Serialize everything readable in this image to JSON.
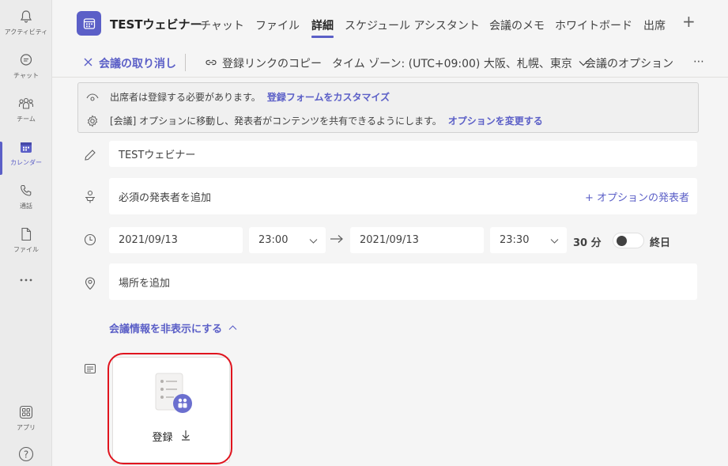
{
  "rail": {
    "items": [
      {
        "label": "アクティビティ",
        "icon": "bell-icon"
      },
      {
        "label": "チャット",
        "icon": "chat-icon"
      },
      {
        "label": "チーム",
        "icon": "teams-icon"
      },
      {
        "label": "カレンダー",
        "icon": "calendar-icon",
        "active": true
      },
      {
        "label": "通話",
        "icon": "phone-icon"
      },
      {
        "label": "ファイル",
        "icon": "file-icon"
      },
      {
        "label": "",
        "icon": "more-icon"
      },
      {
        "label": "アプリ",
        "icon": "apps-icon"
      },
      {
        "label": "",
        "icon": "help-icon"
      }
    ]
  },
  "header": {
    "title": "TESTウェビナー",
    "tabs": [
      {
        "label": "チャット"
      },
      {
        "label": "ファイル"
      },
      {
        "label": "詳細",
        "active": true
      },
      {
        "label": "スケジュール アシスタント"
      },
      {
        "label": "会議のメモ"
      },
      {
        "label": "ホワイトボード"
      },
      {
        "label": "出席"
      }
    ],
    "add_tab": "+"
  },
  "toolbar": {
    "cancel_label": "会議の取り消し",
    "copy_link_label": "登録リンクのコピー",
    "timezone_label": "タイム ゾーン: (UTC+09:00) 大阪、札幌、東京",
    "options_label": "会議のオプション",
    "more_label": "⋯"
  },
  "notice": {
    "line1_text": "出席者は登録する必要があります。",
    "line1_link": "登録フォームをカスタマイズ",
    "line2_text": "[会議] オプションに移動し、発表者がコンテンツを共有できるようにします。",
    "line2_link": "オプションを変更する"
  },
  "form": {
    "title_value": "TESTウェビナー",
    "presenter_placeholder": "必須の発表者を追加",
    "optional_presenter": "+ オプションの発表者",
    "start_date": "2021/09/13",
    "start_time": "23:00",
    "end_date": "2021/09/13",
    "end_time": "23:30",
    "duration": "30 分",
    "all_day_label": "終日",
    "all_day_on": false,
    "location_placeholder": "場所を追加",
    "hide_details_label": "会議情報を非表示にする"
  },
  "registration_card": {
    "label": "登録"
  },
  "colors": {
    "accent": "#5b5fc7",
    "highlight": "#e0141e"
  }
}
